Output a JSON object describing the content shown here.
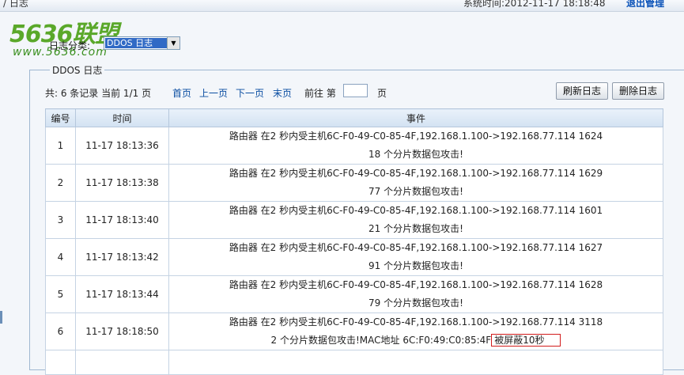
{
  "header": {
    "crumb": "/ 日志",
    "systime": "系统时间:2012-11-17 18:18:48",
    "logout": "退出管理"
  },
  "logo": {
    "main_text": "5636联盟",
    "url_text": "www.5636.com"
  },
  "log_type": {
    "label": "日志分类:",
    "selected": "DDOS 日志"
  },
  "panel": {
    "legend": "DDOS 日志"
  },
  "pager": {
    "summary": "共: 6 条记录 当前 1/1 页",
    "first": "首页",
    "prev": "上一页",
    "next": "下一页",
    "last": "末页",
    "goto_prefix": "前往 第",
    "goto_suffix": "页",
    "page_value": ""
  },
  "buttons": {
    "refresh": "刷新日志",
    "delete": "删除日志"
  },
  "table": {
    "headers": [
      "编号",
      "时间",
      "事件"
    ],
    "rows": [
      {
        "id": "1",
        "time": "11-17 18:13:36",
        "line1": "路由器 在2 秒内受主机6C-F0-49-C0-85-4F,192.168.1.100->192.168.77.114 1624",
        "line2": "18 个分片数据包攻击!"
      },
      {
        "id": "2",
        "time": "11-17 18:13:38",
        "line1": "路由器 在2 秒内受主机6C-F0-49-C0-85-4F,192.168.1.100->192.168.77.114 1629",
        "line2": "77 个分片数据包攻击!"
      },
      {
        "id": "3",
        "time": "11-17 18:13:40",
        "line1": "路由器 在2 秒内受主机6C-F0-49-C0-85-4F,192.168.1.100->192.168.77.114 1601",
        "line2": "21 个分片数据包攻击!"
      },
      {
        "id": "4",
        "time": "11-17 18:13:42",
        "line1": "路由器 在2 秒内受主机6C-F0-49-C0-85-4F,192.168.1.100->192.168.77.114 1627",
        "line2": "91 个分片数据包攻击!"
      },
      {
        "id": "5",
        "time": "11-17 18:13:44",
        "line1": "路由器 在2 秒内受主机6C-F0-49-C0-85-4F,192.168.1.100->192.168.77.114 1628",
        "line2": "79 个分片数据包攻击!"
      },
      {
        "id": "6",
        "time": "11-17 18:18:50",
        "line1": "路由器 在2 秒内受主机6C-F0-49-C0-85-4F,192.168.1.100->192.168.77.114 3118",
        "line2": "2 个分片数据包攻击!MAC地址 6C:F0:49:C0:85:4F",
        "line2_highlight": "被屏蔽10秒"
      }
    ]
  },
  "colors": {
    "link": "#0b4ea2",
    "highlight_border": "#d21c1c",
    "select_highlight": "#316ac5"
  }
}
